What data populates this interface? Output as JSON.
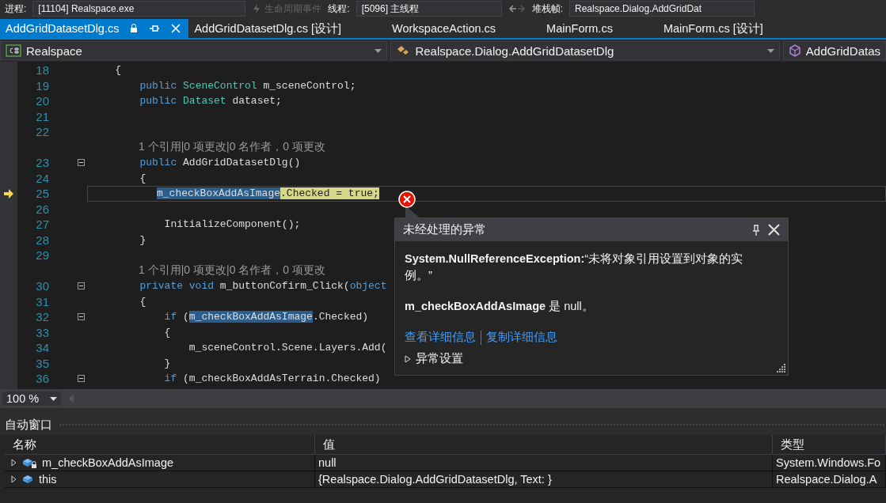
{
  "toolbar": {
    "items": [
      {
        "kind": "label",
        "text": "进程:"
      },
      {
        "kind": "combo",
        "text": "[11104] Realspace.exe"
      },
      {
        "kind": "button",
        "text": "生命周期事件"
      },
      {
        "kind": "label",
        "text": "线程:"
      },
      {
        "kind": "combo",
        "text": "[5096] 主线程"
      },
      {
        "kind": "nav"
      },
      {
        "kind": "label",
        "text": "堆栈帧:"
      },
      {
        "kind": "combo",
        "text": "Realspace.Dialog.AddGridDat"
      }
    ]
  },
  "tabs": [
    {
      "label": "AddGridDatasetDlg.cs",
      "selected": true
    },
    {
      "label": "AddGridDatasetDlg.cs [设计]",
      "selected": false
    },
    {
      "label": "WorkspaceAction.cs",
      "selected": false
    },
    {
      "label": "MainForm.cs",
      "selected": false
    },
    {
      "label": "MainForm.cs [设计]",
      "selected": false
    }
  ],
  "navigation_bar": [
    {
      "kind": "project",
      "text": "Realspace"
    },
    {
      "kind": "class",
      "text": "Realspace.Dialog.AddGridDatasetDlg"
    },
    {
      "kind": "member",
      "text": "AddGridDatas"
    }
  ],
  "editor": {
    "lines": [
      {
        "kind": "code",
        "number": "18",
        "fold": false,
        "current": false,
        "code": [
          {
            "text": "    {",
            "kind": "plain"
          }
        ]
      },
      {
        "kind": "code",
        "number": "19",
        "fold": false,
        "current": false,
        "code": [
          {
            "text": "        public ",
            "kind": "kw"
          },
          {
            "text": "SceneControl",
            "kind": "type"
          },
          {
            "text": " m_sceneControl;",
            "kind": "plain"
          }
        ]
      },
      {
        "kind": "code",
        "number": "20",
        "fold": false,
        "current": false,
        "code": [
          {
            "text": "        public ",
            "kind": "kw"
          },
          {
            "text": "Dataset",
            "kind": "type"
          },
          {
            "text": " dataset;",
            "kind": "plain"
          }
        ]
      },
      {
        "kind": "code",
        "number": "21",
        "fold": false,
        "current": false
      },
      {
        "kind": "code",
        "number": "22",
        "fold": false,
        "current": false
      },
      {
        "kind": "lens",
        "text": "1 个引用|0 项更改|0 名作者，0 项更改"
      },
      {
        "kind": "code",
        "number": "23",
        "fold": true,
        "current": false,
        "code": [
          {
            "text": "        public ",
            "kind": "kw"
          },
          {
            "text": "AddGridDatasetDlg()",
            "kind": "plain"
          }
        ]
      },
      {
        "kind": "code",
        "number": "24",
        "fold": false,
        "current": false,
        "code": [
          {
            "text": "        {",
            "kind": "plain"
          }
        ]
      },
      {
        "kind": "code",
        "number": "25",
        "fold": false,
        "current": true,
        "code": [
          {
            "text": "m_checkBoxAddAsImage",
            "kind": "ref"
          },
          {
            "text": ".Checked = true;",
            "kind": "statement"
          }
        ]
      },
      {
        "kind": "code",
        "number": "26",
        "fold": false,
        "current": false
      },
      {
        "kind": "code",
        "number": "27",
        "fold": false,
        "current": false,
        "code": [
          {
            "text": "            InitializeComponent();",
            "kind": "plain"
          }
        ]
      },
      {
        "kind": "code",
        "number": "28",
        "fold": false,
        "current": false,
        "code": [
          {
            "text": "        }",
            "kind": "plain"
          }
        ]
      },
      {
        "kind": "code",
        "number": "29",
        "fold": false,
        "current": false
      },
      {
        "kind": "lens",
        "text": "1 个引用|0 项更改|0 名作者，0 项更改"
      },
      {
        "kind": "code",
        "number": "30",
        "fold": true,
        "current": false,
        "code": [
          {
            "text": "        private void ",
            "kind": "kw"
          },
          {
            "text": "m_buttonCofirm_Click(",
            "kind": "plain"
          },
          {
            "text": "object",
            "kind": "kw"
          }
        ]
      },
      {
        "kind": "code",
        "number": "31",
        "fold": false,
        "current": false,
        "code": [
          {
            "text": "        {",
            "kind": "plain"
          }
        ]
      },
      {
        "kind": "code",
        "number": "32",
        "fold": true,
        "current": false,
        "code": [
          {
            "text": "            if ",
            "kind": "kw"
          },
          {
            "text": "(",
            "kind": "plain"
          },
          {
            "text": "m_checkBoxAddAsImage",
            "kind": "ref"
          },
          {
            "text": ".Checked)",
            "kind": "plain"
          }
        ]
      },
      {
        "kind": "code",
        "number": "33",
        "fold": false,
        "current": false,
        "code": [
          {
            "text": "            {",
            "kind": "plain"
          }
        ]
      },
      {
        "kind": "code",
        "number": "34",
        "fold": false,
        "current": false,
        "code": [
          {
            "text": "                m_sceneControl.Scene.Layers.Add(",
            "kind": "plain"
          }
        ]
      },
      {
        "kind": "code",
        "number": "35",
        "fold": false,
        "current": false,
        "code": [
          {
            "text": "            }",
            "kind": "plain"
          }
        ]
      },
      {
        "kind": "code",
        "number": "36",
        "fold": true,
        "current": false,
        "code": [
          {
            "text": "            if ",
            "kind": "kw"
          },
          {
            "text": "(m_checkBoxAddAsTerrain.Checked)",
            "kind": "plain"
          }
        ]
      }
    ],
    "zoom": "100 %"
  },
  "exception_popup": {
    "title": "未经处理的异常",
    "message": "**System.NullReferenceException:**“未将对象引用设置到对象的实例。”",
    "detail": "**m_checkBoxAddAsImage** 是 null。",
    "links": [
      "查看详细信息",
      "复制详细信息"
    ],
    "settings": {
      "label": "异常设置",
      "expanded": false
    }
  },
  "autos_window": {
    "title": "自动窗口",
    "columns": [
      "名称",
      "值",
      "类型"
    ],
    "rows": [
      {
        "name": "m_checkBoxAddAsImage",
        "kind": "private_field",
        "expanded": false,
        "value": "null",
        "type": "System.Windows.Fo"
      },
      {
        "name": "this",
        "kind": "object",
        "expanded": false,
        "value": "{Realspace.Dialog.AddGridDatasetDlg, Text: }",
        "type": "Realspace.Dialog.A"
      }
    ]
  }
}
